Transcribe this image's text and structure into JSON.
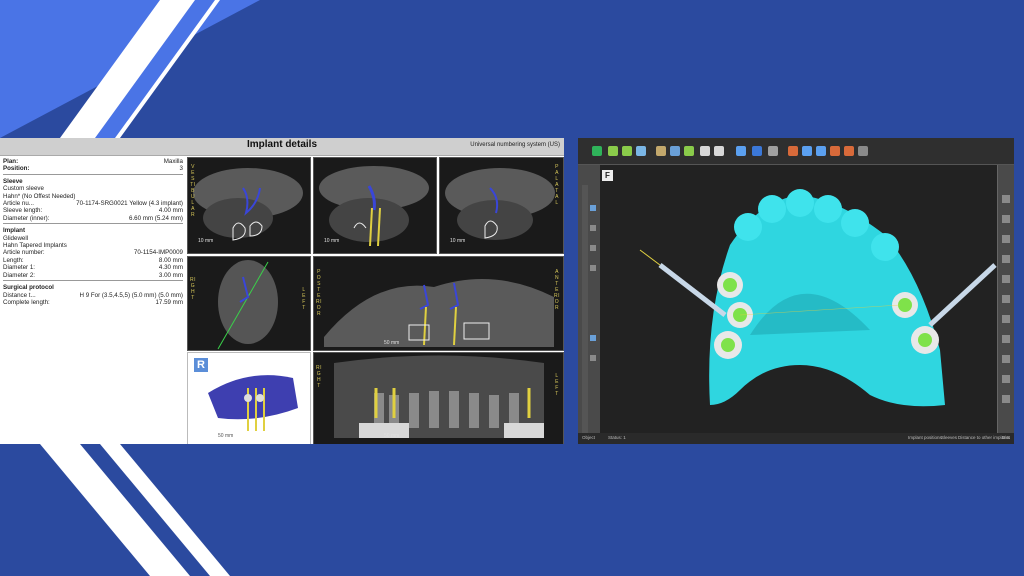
{
  "left_panel": {
    "title": "Implant details",
    "numbering_system": "Universal numbering system (US)",
    "plan": {
      "label": "Plan:",
      "value": "Maxilla"
    },
    "position": {
      "label": "Position:",
      "value": "3"
    },
    "sleeve": {
      "heading": "Sleeve",
      "type": "Custom sleeve",
      "brand": "Hahn* (No Offest Needed)",
      "article_label": "Article nu...",
      "article_value": "70-1174-SRG0021 Yellow (4.3 implant)",
      "length_label": "Sleeve length:",
      "length_value": "4.00 mm",
      "diameter_label": "Diameter (inner):",
      "diameter_value": "6.60 mm (5.24 mm)"
    },
    "implant": {
      "heading": "Implant",
      "manufacturer": "Glidewell",
      "model": "Hahn Tapered Implants",
      "article_label": "Article number:",
      "article_value": "70-1154-IMP0009",
      "length_label": "Length:",
      "length_value": "8.00 mm",
      "d1_label": "Diameter 1:",
      "d1_value": "4.30 mm",
      "d2_label": "Diameter 2:",
      "d2_value": "3.00 mm"
    },
    "protocol": {
      "heading": "Surgical protocol",
      "distance_label": "Distance t...",
      "distance_value": "H 9 For (3.5,4.5,5) (5.0 mm) (5.0 mm)",
      "complete_label": "Complete length:",
      "complete_value": "17.59 mm"
    },
    "ct_views": {
      "vestibular": "VESTIBULAR",
      "palatal": "PALATAL",
      "right": "RIGHT",
      "left": "LEFT",
      "posterior": "POSTERIOR",
      "anterior": "ANTERIOR",
      "right2": "RIGHT",
      "left2": "LEFT",
      "scale_10": "10 mm",
      "scale_50": "50 mm",
      "render_logo": "R"
    }
  },
  "right_panel": {
    "view_marker": "F",
    "status": [
      "Object",
      "Status: 1"
    ],
    "status_right": [
      "Implant positions",
      "Sleeves",
      "Distance to other implants",
      "Dist"
    ],
    "colors": {
      "model": "#2fd6e0",
      "accent_green": "#7fe24a"
    }
  }
}
